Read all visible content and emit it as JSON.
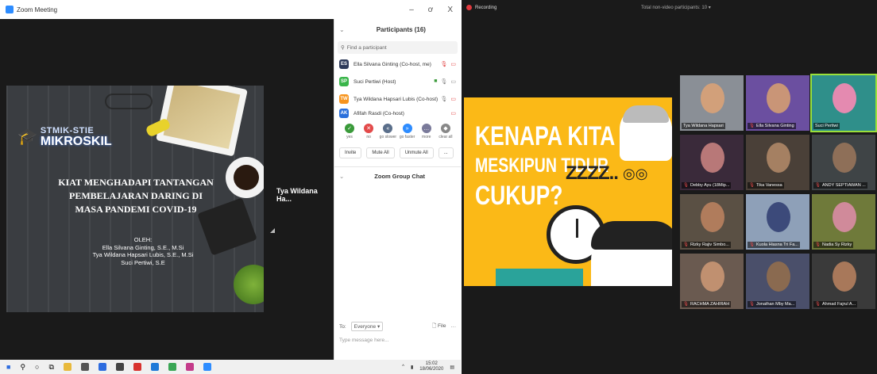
{
  "left_window": {
    "title": "Zoom Meeting",
    "controls": {
      "minimize": "–",
      "restore": "ơ",
      "close": "X"
    },
    "slide": {
      "logo_line1": "STMIK-STIE",
      "logo_line2": "MIKROSKIL",
      "title_line1": "KIAT MENGHADAPI TANTANGAN",
      "title_line2": "PEMBELAJARAN DARING DI",
      "title_line3": "MASA PANDEMI COVID-19",
      "oleh": "OLEH:",
      "author1": "Ella Silvana Ginting, S.E., M.Si",
      "author2": "Tya Wildana Hapsari Lubis, S.E., M.Si",
      "author3": "Suci Pertiwi, S.E"
    },
    "speaker_name": "Tya Wildana Ha...",
    "participants_panel": {
      "header": "Participants (16)",
      "search_placeholder": "Find a participant",
      "rows": [
        {
          "initials": "ES",
          "color": "#2e3a59",
          "name": "Ella Silvana Ginting (Co-host, me)"
        },
        {
          "initials": "SP",
          "color": "#39b54a",
          "name": "Suci Pertiwi (Host)"
        },
        {
          "initials": "TW",
          "color": "#f7941d",
          "name": "Tya Wildana Hapsari Lubis (Co-host)"
        },
        {
          "initials": "AK",
          "color": "#2a6fdb",
          "name": "Afifah Rasdi (Co-host)"
        }
      ],
      "reactions": [
        {
          "label": "yes",
          "color": "#3a9a3a",
          "glyph": "✓"
        },
        {
          "label": "no",
          "color": "#e34a4a",
          "glyph": "✕"
        },
        {
          "label": "go slower",
          "color": "#5a6e8a",
          "glyph": "«"
        },
        {
          "label": "go faster",
          "color": "#2d8cff",
          "glyph": "»"
        },
        {
          "label": "more",
          "color": "#7a7a9a",
          "glyph": "…"
        },
        {
          "label": "clear all",
          "color": "#888888",
          "glyph": "◆"
        }
      ],
      "invite": "Invite",
      "mute_all": "Mute All",
      "unmute_all": "Unmute All",
      "more": "..."
    },
    "chat": {
      "header": "Zoom Group Chat",
      "to_label": "To:",
      "to_value": "Everyone ▾",
      "file_label": "File",
      "more": "···",
      "placeholder": "Type message here..."
    },
    "taskbar": {
      "time": "15:02",
      "date": "18/06/2020"
    }
  },
  "right_window": {
    "recording": "Recording",
    "total_videos": "Total non-video participants: 10 ▾",
    "share_text": {
      "line1": "KENAPA KITA CAPEK",
      "line2": "MESKIPUN TIDUR",
      "line3": "CUKUP?",
      "zzz": "ZZZZ..",
      "glasses": "◎◎"
    },
    "tiles": [
      {
        "name": "Tya Wildana Hapsari",
        "muted": false
      },
      {
        "name": "Ella Silvana Ginting",
        "muted": true
      },
      {
        "name": "Suci Pertiwi",
        "muted": false
      },
      {
        "name": "Debby Ayu (18Mip...",
        "muted": true
      },
      {
        "name": "Tika Vanessa",
        "muted": true
      },
      {
        "name": "ANDY SEPTIAWAN ...",
        "muted": true
      },
      {
        "name": "Rizky Rajiv Simbo...",
        "muted": true
      },
      {
        "name": "Kuola Hiasna Tri Fa...",
        "muted": true
      },
      {
        "name": "Nadia Sy Rizky",
        "muted": true
      },
      {
        "name": "RACHMA ZAHIRAH",
        "muted": true
      },
      {
        "name": "Jonathan Mby Ma...",
        "muted": true
      },
      {
        "name": "Ahmad Fajrul A...",
        "muted": true
      }
    ]
  }
}
